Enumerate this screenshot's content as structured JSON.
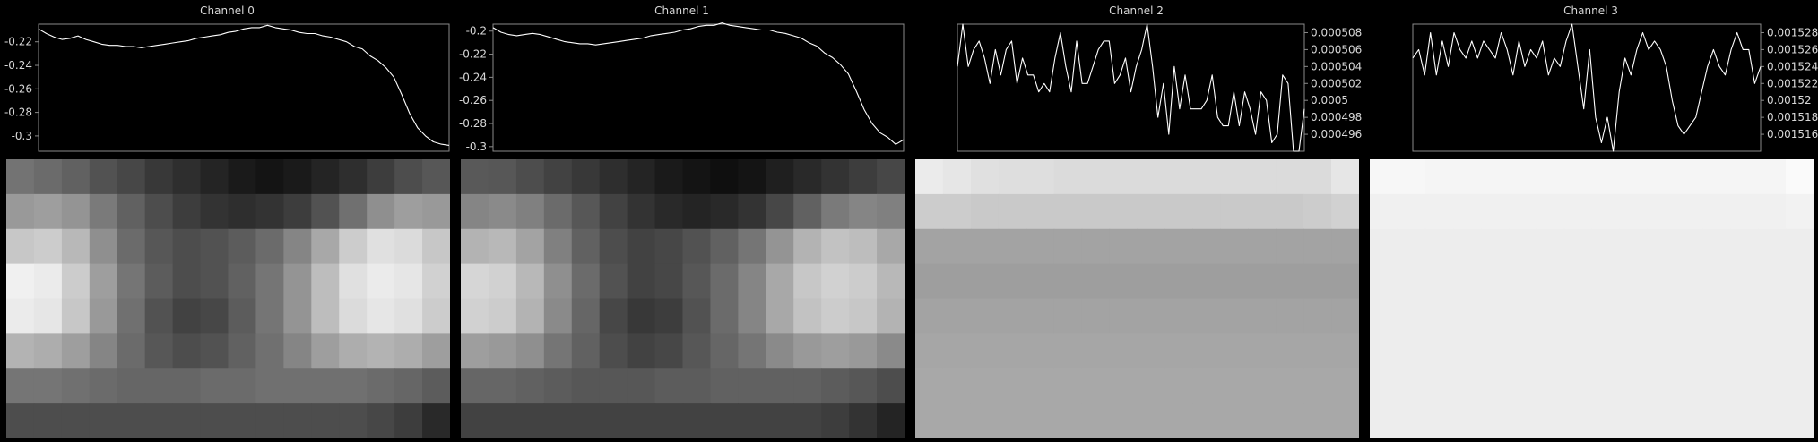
{
  "chart_data": [
    {
      "type": "line",
      "title": "Channel 0",
      "y_axis_side": "left",
      "ylim": [
        -0.313,
        -0.205
      ],
      "yticks": [
        -0.22,
        -0.24,
        -0.26,
        -0.28,
        -0.3
      ],
      "ytick_labels": [
        "-0.22",
        "-0.24",
        "-0.26",
        "-0.28",
        "-0.3"
      ],
      "grid": false,
      "values": [
        -0.209,
        -0.213,
        -0.216,
        -0.218,
        -0.217,
        -0.215,
        -0.218,
        -0.22,
        -0.222,
        -0.223,
        -0.223,
        -0.224,
        -0.224,
        -0.225,
        -0.224,
        -0.223,
        -0.222,
        -0.221,
        -0.22,
        -0.219,
        -0.217,
        -0.216,
        -0.215,
        -0.214,
        -0.212,
        -0.211,
        -0.209,
        -0.208,
        -0.208,
        -0.206,
        -0.208,
        -0.209,
        -0.21,
        -0.212,
        -0.213,
        -0.213,
        -0.215,
        -0.216,
        -0.218,
        -0.22,
        -0.224,
        -0.226,
        -0.232,
        -0.236,
        -0.242,
        -0.25,
        -0.265,
        -0.281,
        -0.293,
        -0.3,
        -0.305,
        -0.307,
        -0.308
      ]
    },
    {
      "type": "line",
      "title": "Channel 1",
      "y_axis_side": "left",
      "ylim": [
        -0.304,
        -0.194
      ],
      "yticks": [
        -0.2,
        -0.22,
        -0.24,
        -0.26,
        -0.28,
        -0.3
      ],
      "ytick_labels": [
        "-0.2",
        "-0.22",
        "-0.24",
        "-0.26",
        "-0.28",
        "-0.3"
      ],
      "grid": false,
      "values": [
        -0.197,
        -0.201,
        -0.203,
        -0.204,
        -0.203,
        -0.202,
        -0.203,
        -0.205,
        -0.207,
        -0.209,
        -0.21,
        -0.211,
        -0.211,
        -0.212,
        -0.211,
        -0.21,
        -0.209,
        -0.208,
        -0.207,
        -0.206,
        -0.204,
        -0.203,
        -0.202,
        -0.201,
        -0.199,
        -0.198,
        -0.196,
        -0.195,
        -0.195,
        -0.193,
        -0.195,
        -0.196,
        -0.197,
        -0.198,
        -0.199,
        -0.199,
        -0.201,
        -0.202,
        -0.204,
        -0.206,
        -0.21,
        -0.213,
        -0.219,
        -0.223,
        -0.229,
        -0.237,
        -0.252,
        -0.268,
        -0.28,
        -0.288,
        -0.292,
        -0.298,
        -0.294
      ]
    },
    {
      "type": "line",
      "title": "Channel 2",
      "y_axis_side": "right",
      "ylim": [
        0.000494,
        0.000509
      ],
      "yticks": [
        0.000508,
        0.000506,
        0.000504,
        0.000502,
        0.0005,
        0.000498,
        0.000496
      ],
      "ytick_labels": [
        "0.000508",
        "0.000506",
        "0.000504",
        "0.000502",
        "0.0005",
        "0.000498",
        "0.000496"
      ],
      "grid": false,
      "values": [
        0.000504,
        0.000509,
        0.000504,
        0.000506,
        0.000507,
        0.000505,
        0.000502,
        0.000506,
        0.000503,
        0.000506,
        0.000507,
        0.000502,
        0.000505,
        0.000503,
        0.000503,
        0.000501,
        0.000502,
        0.000501,
        0.000505,
        0.000508,
        0.000504,
        0.000501,
        0.000507,
        0.000502,
        0.000502,
        0.000504,
        0.000506,
        0.000507,
        0.000507,
        0.000502,
        0.000503,
        0.000505,
        0.000501,
        0.000504,
        0.000506,
        0.000509,
        0.000504,
        0.000498,
        0.000502,
        0.000496,
        0.000504,
        0.000499,
        0.000503,
        0.000499,
        0.000499,
        0.000499,
        0.0005,
        0.000503,
        0.000498,
        0.000497,
        0.000497,
        0.000501,
        0.000497,
        0.000501,
        0.000499,
        0.000496,
        0.000501,
        0.0005,
        0.000495,
        0.000496,
        0.000503,
        0.000502,
        0.000494,
        0.000494,
        0.000499
      ]
    },
    {
      "type": "line",
      "title": "Channel 3",
      "y_axis_side": "right",
      "ylim": [
        0.001514,
        0.001529
      ],
      "yticks": [
        0.001528,
        0.001526,
        0.001524,
        0.001522,
        0.00152,
        0.001518,
        0.001516
      ],
      "ytick_labels": [
        "0.001528",
        "0.001526",
        "0.001524",
        "0.001522",
        "0.00152",
        "0.001518",
        "0.001516"
      ],
      "grid": false,
      "values": [
        0.001525,
        0.001526,
        0.001523,
        0.001528,
        0.001523,
        0.001527,
        0.001524,
        0.001528,
        0.001526,
        0.001525,
        0.001527,
        0.001525,
        0.001527,
        0.001526,
        0.001525,
        0.001528,
        0.001526,
        0.001523,
        0.001527,
        0.001524,
        0.001526,
        0.001525,
        0.001527,
        0.001523,
        0.001525,
        0.001524,
        0.001527,
        0.001529,
        0.001524,
        0.001519,
        0.001526,
        0.001518,
        0.001515,
        0.001518,
        0.001514,
        0.001521,
        0.001525,
        0.001523,
        0.001526,
        0.001528,
        0.001526,
        0.001527,
        0.001526,
        0.001524,
        0.00152,
        0.001517,
        0.001516,
        0.001517,
        0.001518,
        0.001521,
        0.001524,
        0.001526,
        0.001524,
        0.001523,
        0.001526,
        0.001528,
        0.001526,
        0.001526,
        0.001522,
        0.001524
      ]
    }
  ],
  "heatmaps": [
    {
      "colormap": "gray",
      "rows": [
        [
          0.45,
          0.42,
          0.38,
          0.32,
          0.28,
          0.22,
          0.18,
          0.14,
          0.1,
          0.08,
          0.1,
          0.14,
          0.18,
          0.24,
          0.3,
          0.34
        ],
        [
          0.6,
          0.62,
          0.58,
          0.48,
          0.38,
          0.3,
          0.24,
          0.2,
          0.18,
          0.2,
          0.24,
          0.32,
          0.44,
          0.56,
          0.62,
          0.6
        ],
        [
          0.78,
          0.8,
          0.72,
          0.56,
          0.42,
          0.34,
          0.3,
          0.32,
          0.36,
          0.42,
          0.52,
          0.66,
          0.8,
          0.88,
          0.86,
          0.78
        ],
        [
          0.94,
          0.92,
          0.8,
          0.62,
          0.46,
          0.36,
          0.3,
          0.32,
          0.38,
          0.46,
          0.58,
          0.74,
          0.88,
          0.92,
          0.9,
          0.82
        ],
        [
          0.92,
          0.9,
          0.78,
          0.6,
          0.44,
          0.32,
          0.26,
          0.28,
          0.36,
          0.46,
          0.58,
          0.74,
          0.86,
          0.9,
          0.88,
          0.8
        ],
        [
          0.7,
          0.68,
          0.62,
          0.52,
          0.42,
          0.34,
          0.3,
          0.32,
          0.38,
          0.44,
          0.52,
          0.62,
          0.68,
          0.7,
          0.68,
          0.62
        ],
        [
          0.46,
          0.46,
          0.44,
          0.42,
          0.4,
          0.4,
          0.4,
          0.42,
          0.42,
          0.44,
          0.44,
          0.44,
          0.44,
          0.42,
          0.4,
          0.36
        ],
        [
          0.3,
          0.3,
          0.3,
          0.3,
          0.3,
          0.3,
          0.3,
          0.3,
          0.3,
          0.3,
          0.3,
          0.3,
          0.3,
          0.28,
          0.24,
          0.16
        ]
      ]
    },
    {
      "colormap": "gray",
      "rows": [
        [
          0.35,
          0.34,
          0.3,
          0.26,
          0.22,
          0.18,
          0.14,
          0.1,
          0.08,
          0.06,
          0.08,
          0.12,
          0.16,
          0.2,
          0.24,
          0.28
        ],
        [
          0.52,
          0.54,
          0.5,
          0.42,
          0.34,
          0.26,
          0.2,
          0.16,
          0.14,
          0.16,
          0.2,
          0.28,
          0.38,
          0.48,
          0.52,
          0.5
        ],
        [
          0.7,
          0.72,
          0.64,
          0.5,
          0.38,
          0.3,
          0.26,
          0.28,
          0.32,
          0.38,
          0.46,
          0.58,
          0.7,
          0.76,
          0.74,
          0.66
        ],
        [
          0.84,
          0.82,
          0.72,
          0.56,
          0.42,
          0.32,
          0.26,
          0.28,
          0.34,
          0.42,
          0.52,
          0.66,
          0.78,
          0.82,
          0.8,
          0.72
        ],
        [
          0.82,
          0.8,
          0.7,
          0.54,
          0.4,
          0.28,
          0.22,
          0.24,
          0.32,
          0.42,
          0.52,
          0.66,
          0.76,
          0.8,
          0.78,
          0.7
        ],
        [
          0.62,
          0.6,
          0.56,
          0.46,
          0.38,
          0.3,
          0.26,
          0.28,
          0.34,
          0.4,
          0.46,
          0.54,
          0.6,
          0.62,
          0.6,
          0.54
        ],
        [
          0.4,
          0.4,
          0.38,
          0.36,
          0.34,
          0.34,
          0.34,
          0.36,
          0.36,
          0.38,
          0.38,
          0.38,
          0.38,
          0.36,
          0.34,
          0.3
        ],
        [
          0.26,
          0.26,
          0.26,
          0.26,
          0.26,
          0.26,
          0.26,
          0.26,
          0.26,
          0.26,
          0.26,
          0.26,
          0.26,
          0.24,
          0.2,
          0.14
        ]
      ]
    },
    {
      "colormap": "gray",
      "rows": [
        [
          0.92,
          0.9,
          0.88,
          0.87,
          0.87,
          0.86,
          0.86,
          0.86,
          0.86,
          0.86,
          0.86,
          0.86,
          0.86,
          0.86,
          0.86,
          0.9
        ],
        [
          0.8,
          0.8,
          0.79,
          0.79,
          0.79,
          0.79,
          0.79,
          0.79,
          0.79,
          0.79,
          0.79,
          0.79,
          0.79,
          0.79,
          0.8,
          0.82
        ],
        [
          0.64,
          0.64,
          0.64,
          0.64,
          0.64,
          0.64,
          0.64,
          0.64,
          0.64,
          0.64,
          0.64,
          0.64,
          0.64,
          0.64,
          0.64,
          0.64
        ],
        [
          0.62,
          0.62,
          0.62,
          0.62,
          0.62,
          0.62,
          0.62,
          0.62,
          0.62,
          0.62,
          0.62,
          0.62,
          0.62,
          0.62,
          0.62,
          0.62
        ],
        [
          0.64,
          0.64,
          0.64,
          0.64,
          0.64,
          0.64,
          0.64,
          0.64,
          0.64,
          0.64,
          0.64,
          0.64,
          0.64,
          0.64,
          0.64,
          0.64
        ],
        [
          0.65,
          0.65,
          0.65,
          0.65,
          0.65,
          0.65,
          0.65,
          0.65,
          0.65,
          0.65,
          0.65,
          0.65,
          0.65,
          0.65,
          0.65,
          0.65
        ],
        [
          0.66,
          0.66,
          0.66,
          0.66,
          0.66,
          0.66,
          0.66,
          0.66,
          0.66,
          0.66,
          0.66,
          0.66,
          0.66,
          0.66,
          0.66,
          0.66
        ],
        [
          0.66,
          0.66,
          0.66,
          0.66,
          0.66,
          0.66,
          0.66,
          0.66,
          0.66,
          0.66,
          0.66,
          0.66,
          0.66,
          0.66,
          0.66,
          0.66
        ]
      ]
    },
    {
      "colormap": "gray",
      "rows": [
        [
          0.97,
          0.97,
          0.96,
          0.96,
          0.96,
          0.96,
          0.96,
          0.96,
          0.96,
          0.96,
          0.96,
          0.96,
          0.96,
          0.96,
          0.96,
          0.98
        ],
        [
          0.94,
          0.94,
          0.94,
          0.94,
          0.94,
          0.94,
          0.94,
          0.94,
          0.94,
          0.94,
          0.94,
          0.94,
          0.94,
          0.94,
          0.94,
          0.95
        ],
        [
          0.93,
          0.93,
          0.93,
          0.93,
          0.93,
          0.93,
          0.93,
          0.93,
          0.93,
          0.93,
          0.93,
          0.93,
          0.93,
          0.93,
          0.93,
          0.93
        ],
        [
          0.93,
          0.93,
          0.93,
          0.93,
          0.93,
          0.93,
          0.93,
          0.93,
          0.93,
          0.93,
          0.93,
          0.93,
          0.93,
          0.93,
          0.93,
          0.93
        ],
        [
          0.93,
          0.93,
          0.93,
          0.93,
          0.93,
          0.93,
          0.93,
          0.93,
          0.93,
          0.93,
          0.93,
          0.93,
          0.93,
          0.93,
          0.93,
          0.93
        ],
        [
          0.93,
          0.93,
          0.93,
          0.93,
          0.93,
          0.93,
          0.93,
          0.93,
          0.93,
          0.93,
          0.93,
          0.93,
          0.93,
          0.93,
          0.93,
          0.93
        ],
        [
          0.93,
          0.93,
          0.93,
          0.93,
          0.93,
          0.93,
          0.93,
          0.93,
          0.93,
          0.93,
          0.93,
          0.93,
          0.93,
          0.93,
          0.93,
          0.93
        ],
        [
          0.93,
          0.93,
          0.93,
          0.93,
          0.93,
          0.93,
          0.93,
          0.93,
          0.93,
          0.93,
          0.93,
          0.93,
          0.93,
          0.93,
          0.93,
          0.93
        ]
      ]
    }
  ],
  "colors": {
    "background": "#000000",
    "line": "#ffffff",
    "axis": "#8a8a8a",
    "text": "#d8d8d8"
  }
}
